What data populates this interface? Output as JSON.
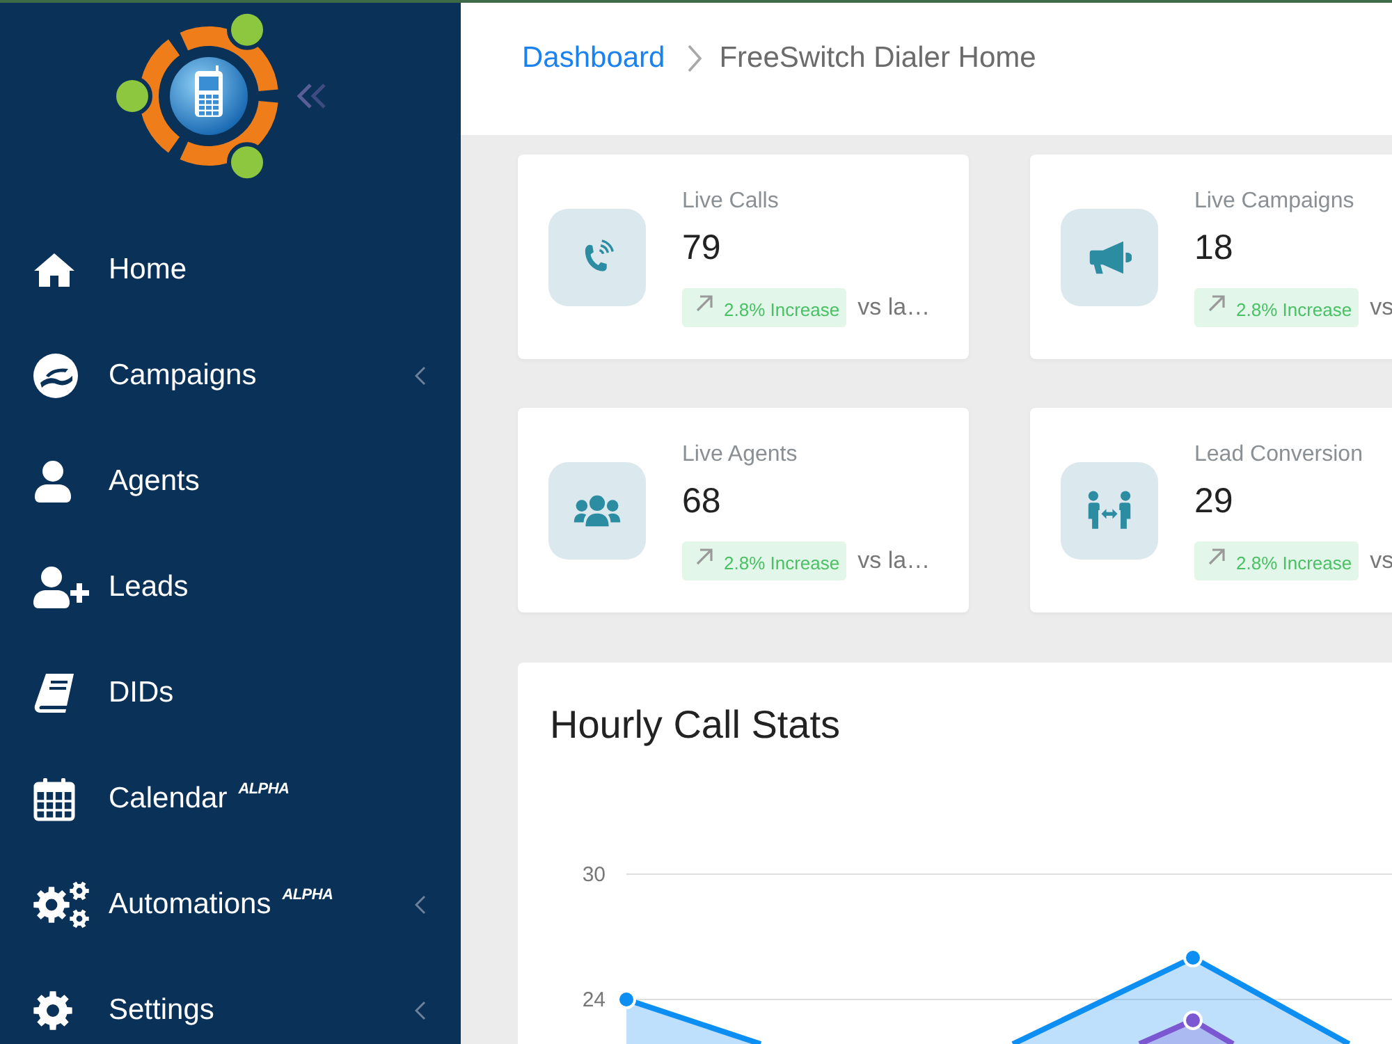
{
  "sidebar": {
    "items": [
      {
        "kind": "home",
        "label": "Home",
        "has_submenu": false
      },
      {
        "kind": "campaigns",
        "label": "Campaigns",
        "has_submenu": true
      },
      {
        "kind": "agents",
        "label": "Agents",
        "has_submenu": false
      },
      {
        "kind": "leads",
        "label": "Leads",
        "has_submenu": false
      },
      {
        "kind": "dids",
        "label": "DIDs",
        "has_submenu": false
      },
      {
        "kind": "calendar",
        "label": "Calendar",
        "tag": "ALPHA",
        "has_submenu": false
      },
      {
        "kind": "automations",
        "label": "Automations",
        "tag": "ALPHA",
        "has_submenu": true
      },
      {
        "kind": "settings",
        "label": "Settings",
        "has_submenu": true
      }
    ]
  },
  "breadcrumb": [
    {
      "label": "Dashboard",
      "current": false
    },
    {
      "label": "FreeSwitch Dialer Home",
      "current": true
    }
  ],
  "stat_cards": [
    {
      "kind": "calls",
      "title": "Live Calls",
      "value": "79",
      "increase": true,
      "change": "2.8% Increase",
      "comparison": "vs la…"
    },
    {
      "kind": "campaigns",
      "title": "Live Campaigns",
      "value": "18",
      "increase": true,
      "change": "2.8% Increase",
      "comparison": "vs"
    },
    {
      "kind": "agents",
      "title": "Live Agents",
      "value": "68",
      "increase": true,
      "change": "2.8% Increase",
      "comparison": "vs la…"
    },
    {
      "kind": "conversion",
      "title": "Lead Conversion",
      "value": "29",
      "increase": true,
      "change": "2.8% Increase",
      "comparison": "vs"
    }
  ],
  "chart_card": {
    "title": "Hourly Call Stats",
    "y_axis_labels": [
      "30",
      "24"
    ]
  }
}
